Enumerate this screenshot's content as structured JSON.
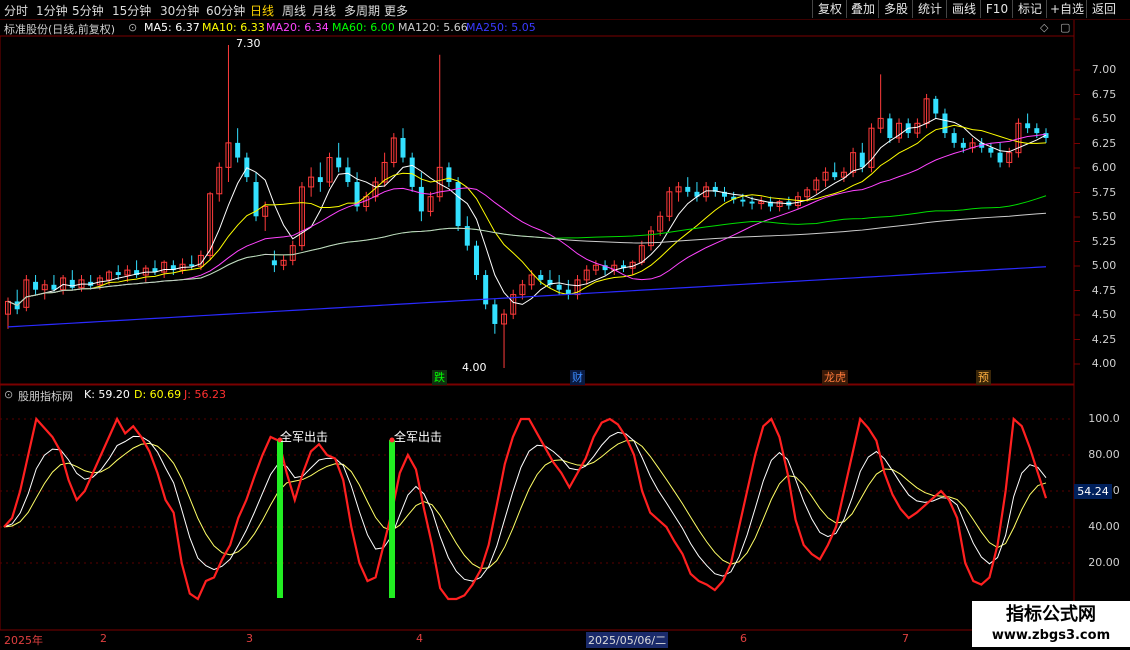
{
  "period_tabs": [
    "分时",
    "1分钟",
    "5分钟",
    "15分钟",
    "30分钟",
    "60分钟",
    "日线",
    "周线",
    "月线",
    "多周期",
    "更多"
  ],
  "active_tab": "日线",
  "right_buttons": [
    "复权",
    "叠加",
    "多股",
    "统计",
    "画线",
    "F10",
    "标记",
    "+自选",
    "返回"
  ],
  "stock": {
    "title": "标准股份(日线,前复权)"
  },
  "ma_info": [
    {
      "label": "MA5: 6.37",
      "color": "#ffffff"
    },
    {
      "label": "MA10: 6.33",
      "color": "#ffff00"
    },
    {
      "label": "MA20: 6.34",
      "color": "#ff44ff"
    },
    {
      "label": "MA60: 6.00",
      "color": "#00ff00"
    },
    {
      "label": "MA120: 5.66",
      "color": "#cccccc"
    },
    {
      "label": "MA250: 5.05",
      "color": "#3a3aff"
    }
  ],
  "indicator_info": {
    "name": "股朋指标网",
    "k": "K: 59.20",
    "d": "D: 60.69",
    "j": "J: 56.23"
  },
  "price_axis": [
    "7.00",
    "6.75",
    "6.50",
    "6.25",
    "6.00",
    "5.75",
    "5.50",
    "5.25",
    "5.00",
    "4.75",
    "4.50",
    "4.25",
    "4.00"
  ],
  "indicator_axis": [
    "100.0",
    "80.00",
    "60.00",
    "40.00",
    "20.00"
  ],
  "current_indicator_value": "54.24",
  "price_annotations": {
    "high": "7.30",
    "low": "4.00"
  },
  "events": [
    {
      "label": "跌",
      "color": "#00ff00",
      "bg": "#103010"
    },
    {
      "label": "财",
      "color": "#3c8cff",
      "bg": "#0a1a40"
    },
    {
      "label": "龙虎",
      "color": "#ff7a3a",
      "bg": "#3a1a08"
    },
    {
      "label": "预",
      "color": "#ffb040",
      "bg": "#3a2608"
    }
  ],
  "signals": [
    {
      "label": "全军出击"
    },
    {
      "label": "全军出击"
    }
  ],
  "time_axis": [
    "2025年",
    "2",
    "3",
    "4",
    "2025/05/06/二",
    "6",
    "7"
  ],
  "watermark": {
    "line1": "指标公式网",
    "line2": "www.zbgs3.com"
  },
  "chart_data": {
    "type": "candlestick",
    "price_range": [
      4.0,
      7.3
    ],
    "candles_ohlc": [
      [
        4.55,
        4.72,
        4.4,
        4.68
      ],
      [
        4.68,
        4.8,
        4.55,
        4.6
      ],
      [
        4.62,
        4.95,
        4.58,
        4.9
      ],
      [
        4.88,
        4.95,
        4.75,
        4.8
      ],
      [
        4.8,
        4.9,
        4.7,
        4.85
      ],
      [
        4.85,
        4.95,
        4.78,
        4.8
      ],
      [
        4.8,
        4.95,
        4.75,
        4.92
      ],
      [
        4.9,
        5.0,
        4.8,
        4.82
      ],
      [
        4.82,
        4.95,
        4.78,
        4.9
      ],
      [
        4.88,
        4.95,
        4.8,
        4.84
      ],
      [
        4.85,
        4.95,
        4.8,
        4.92
      ],
      [
        4.9,
        5.0,
        4.85,
        4.98
      ],
      [
        4.98,
        5.05,
        4.9,
        4.95
      ],
      [
        4.95,
        5.05,
        4.88,
        5.0
      ],
      [
        5.0,
        5.1,
        4.92,
        4.95
      ],
      [
        4.95,
        5.05,
        4.88,
        5.02
      ],
      [
        5.02,
        5.1,
        4.95,
        4.98
      ],
      [
        4.98,
        5.1,
        4.92,
        5.08
      ],
      [
        5.05,
        5.1,
        4.95,
        5.0
      ],
      [
        5.0,
        5.12,
        4.96,
        5.06
      ],
      [
        5.06,
        5.15,
        5.0,
        5.04
      ],
      [
        5.04,
        5.2,
        5.0,
        5.15
      ],
      [
        5.15,
        5.8,
        5.1,
        5.78
      ],
      [
        5.78,
        6.1,
        5.7,
        6.05
      ],
      [
        6.05,
        7.3,
        5.9,
        6.3
      ],
      [
        6.3,
        6.45,
        6.1,
        6.15
      ],
      [
        6.15,
        6.2,
        5.9,
        5.95
      ],
      [
        5.9,
        6.0,
        5.5,
        5.55
      ],
      [
        5.55,
        5.7,
        5.4,
        5.65
      ],
      [
        5.1,
        5.2,
        4.98,
        5.05
      ],
      [
        5.05,
        5.15,
        5.0,
        5.1
      ],
      [
        5.1,
        5.3,
        5.05,
        5.25
      ],
      [
        5.25,
        5.9,
        5.2,
        5.85
      ],
      [
        5.85,
        6.05,
        5.75,
        5.95
      ],
      [
        5.95,
        6.1,
        5.8,
        5.9
      ],
      [
        5.9,
        6.2,
        5.85,
        6.15
      ],
      [
        6.15,
        6.3,
        6.0,
        6.05
      ],
      [
        6.05,
        6.15,
        5.85,
        5.9
      ],
      [
        5.9,
        6.0,
        5.6,
        5.65
      ],
      [
        5.65,
        5.8,
        5.6,
        5.75
      ],
      [
        5.75,
        5.95,
        5.7,
        5.9
      ],
      [
        5.9,
        6.2,
        5.85,
        6.1
      ],
      [
        6.1,
        6.4,
        6.05,
        6.35
      ],
      [
        6.35,
        6.45,
        6.1,
        6.15
      ],
      [
        6.15,
        6.2,
        5.8,
        5.85
      ],
      [
        5.85,
        6.0,
        5.5,
        5.6
      ],
      [
        5.6,
        5.8,
        5.55,
        5.75
      ],
      [
        5.75,
        7.2,
        5.7,
        6.05
      ],
      [
        6.05,
        6.1,
        5.85,
        5.9
      ],
      [
        5.9,
        5.95,
        5.4,
        5.45
      ],
      [
        5.45,
        5.55,
        5.2,
        5.25
      ],
      [
        5.25,
        5.3,
        4.9,
        4.95
      ],
      [
        4.95,
        5.0,
        4.6,
        4.65
      ],
      [
        4.65,
        4.7,
        4.35,
        4.45
      ],
      [
        4.45,
        4.6,
        4.0,
        4.55
      ],
      [
        4.55,
        4.8,
        4.5,
        4.75
      ],
      [
        4.75,
        4.9,
        4.7,
        4.85
      ],
      [
        4.85,
        5.0,
        4.8,
        4.95
      ],
      [
        4.95,
        5.0,
        4.85,
        4.9
      ],
      [
        4.9,
        5.0,
        4.82,
        4.85
      ],
      [
        4.85,
        4.95,
        4.75,
        4.8
      ],
      [
        4.8,
        4.9,
        4.7,
        4.75
      ],
      [
        4.75,
        4.95,
        4.7,
        4.9
      ],
      [
        4.9,
        5.05,
        4.85,
        5.0
      ],
      [
        5.0,
        5.1,
        4.95,
        5.05
      ],
      [
        5.05,
        5.1,
        4.95,
        5.0
      ],
      [
        5.0,
        5.1,
        4.95,
        5.05
      ],
      [
        5.05,
        5.1,
        4.98,
        5.02
      ],
      [
        5.02,
        5.1,
        4.95,
        5.08
      ],
      [
        5.08,
        5.3,
        5.05,
        5.25
      ],
      [
        5.25,
        5.45,
        5.2,
        5.4
      ],
      [
        5.4,
        5.6,
        5.35,
        5.55
      ],
      [
        5.55,
        5.85,
        5.5,
        5.8
      ],
      [
        5.8,
        5.9,
        5.7,
        5.85
      ],
      [
        5.85,
        5.95,
        5.75,
        5.8
      ],
      [
        5.8,
        5.9,
        5.7,
        5.75
      ],
      [
        5.75,
        5.9,
        5.7,
        5.85
      ],
      [
        5.85,
        5.9,
        5.75,
        5.8
      ],
      [
        5.8,
        5.85,
        5.7,
        5.75
      ],
      [
        5.75,
        5.8,
        5.68,
        5.72
      ],
      [
        5.72,
        5.78,
        5.65,
        5.7
      ],
      [
        5.7,
        5.75,
        5.62,
        5.68
      ],
      [
        5.68,
        5.75,
        5.62,
        5.7
      ],
      [
        5.7,
        5.75,
        5.6,
        5.65
      ],
      [
        5.65,
        5.72,
        5.6,
        5.7
      ],
      [
        5.7,
        5.75,
        5.62,
        5.66
      ],
      [
        5.66,
        5.8,
        5.62,
        5.75
      ],
      [
        5.75,
        5.85,
        5.7,
        5.82
      ],
      [
        5.82,
        5.95,
        5.78,
        5.92
      ],
      [
        5.92,
        6.05,
        5.85,
        6.0
      ],
      [
        6.0,
        6.1,
        5.92,
        5.95
      ],
      [
        5.95,
        6.05,
        5.9,
        6.0
      ],
      [
        6.0,
        6.25,
        5.95,
        6.2
      ],
      [
        6.2,
        6.3,
        6.0,
        6.05
      ],
      [
        6.05,
        6.5,
        6.0,
        6.45
      ],
      [
        6.45,
        7.0,
        6.4,
        6.55
      ],
      [
        6.55,
        6.6,
        6.3,
        6.35
      ],
      [
        6.35,
        6.55,
        6.3,
        6.5
      ],
      [
        6.5,
        6.55,
        6.35,
        6.4
      ],
      [
        6.4,
        6.55,
        6.35,
        6.5
      ],
      [
        6.5,
        6.8,
        6.45,
        6.75
      ],
      [
        6.75,
        6.78,
        6.55,
        6.6
      ],
      [
        6.6,
        6.65,
        6.35,
        6.4
      ],
      [
        6.4,
        6.45,
        6.25,
        6.3
      ],
      [
        6.3,
        6.35,
        6.2,
        6.25
      ],
      [
        6.25,
        6.35,
        6.2,
        6.3
      ],
      [
        6.3,
        6.35,
        6.2,
        6.25
      ],
      [
        6.25,
        6.3,
        6.15,
        6.2
      ],
      [
        6.2,
        6.3,
        6.05,
        6.1
      ],
      [
        6.1,
        6.25,
        6.05,
        6.2
      ],
      [
        6.2,
        6.55,
        6.15,
        6.5
      ],
      [
        6.5,
        6.6,
        6.4,
        6.45
      ],
      [
        6.45,
        6.5,
        6.35,
        6.4
      ],
      [
        6.4,
        6.45,
        6.3,
        6.35
      ]
    ],
    "indicator": {
      "K": [
        40,
        45,
        60,
        80,
        100,
        95,
        90,
        82,
        66,
        55,
        60,
        70,
        80,
        90,
        100,
        92,
        96,
        90,
        82,
        70,
        55,
        48,
        20,
        3,
        0,
        10,
        12,
        22,
        30,
        45,
        55,
        68,
        80,
        90,
        88,
        70,
        55,
        70,
        82,
        86,
        80,
        78,
        66,
        40,
        20,
        10,
        12,
        30,
        48,
        70,
        80,
        72,
        50,
        30,
        6,
        0,
        0,
        2,
        8,
        16,
        30,
        52,
        75,
        90,
        100,
        100,
        92,
        84,
        76,
        70,
        62,
        70,
        78,
        90,
        98,
        100,
        97,
        90,
        80,
        60,
        48,
        44,
        40,
        32,
        25,
        14,
        10,
        8,
        5,
        10,
        20,
        40,
        60,
        80,
        96,
        100,
        90,
        70,
        44,
        30,
        25,
        22,
        30,
        40,
        60,
        80,
        100,
        95,
        88,
        70,
        58,
        50,
        45,
        48,
        52,
        56,
        60,
        55,
        45,
        20,
        10,
        8,
        12,
        30,
        60,
        100,
        96,
        84,
        70,
        56
      ]
    }
  }
}
